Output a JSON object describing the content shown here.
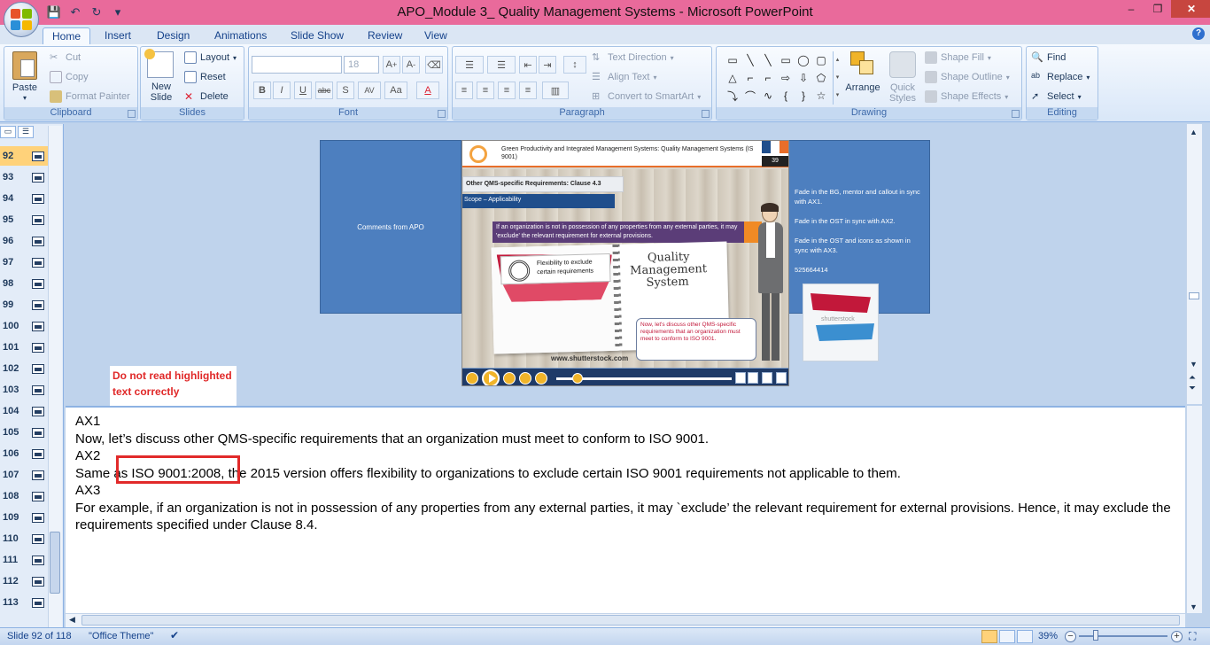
{
  "window": {
    "title": "APO_Module 3_ Quality Management Systems - Microsoft PowerPoint",
    "minimize": "–",
    "restore": "❐",
    "close": "✕"
  },
  "qat": {
    "save": "💾",
    "undo": "↶",
    "redo": "↻",
    "customize": "▾"
  },
  "tabs": [
    "Home",
    "Insert",
    "Design",
    "Animations",
    "Slide Show",
    "Review",
    "View"
  ],
  "ribbon": {
    "clipboard": {
      "label": "Clipboard",
      "paste": "Paste",
      "cut": "Cut",
      "copy": "Copy",
      "format_painter": "Format Painter"
    },
    "slides": {
      "label": "Slides",
      "new_slide": "New Slide",
      "layout": "Layout",
      "reset": "Reset",
      "delete": "Delete"
    },
    "font": {
      "label": "Font",
      "font_name": "",
      "font_size": "18",
      "bold": "B",
      "italic": "I",
      "underline": "U",
      "strike": "abc",
      "shadow": "S",
      "spacing": "AV",
      "case": "Aa",
      "color": "A"
    },
    "paragraph": {
      "label": "Paragraph",
      "text_direction": "Text Direction",
      "align_text": "Align Text",
      "convert_smartart": "Convert to SmartArt"
    },
    "drawing": {
      "label": "Drawing",
      "arrange": "Arrange",
      "quick_styles": "Quick Styles",
      "shape_fill": "Shape Fill",
      "shape_outline": "Shape Outline",
      "shape_effects": "Shape Effects"
    },
    "editing": {
      "label": "Editing",
      "find": "Find",
      "replace": "Replace",
      "select": "Select"
    }
  },
  "slide_list": [
    "92",
    "93",
    "94",
    "95",
    "96",
    "97",
    "98",
    "99",
    "100",
    "101",
    "102",
    "103",
    "104",
    "105",
    "106",
    "107",
    "108",
    "109",
    "110",
    "111",
    "112",
    "113"
  ],
  "slide_pane": {
    "comments_box": "Comments from APO",
    "notes_box": [
      "Fade in the BG, mentor and callout in sync with AX1.",
      "Fade in the OST in sync with AX2.",
      "Fade in the OST and icons as shown in sync with AX3.",
      "525664414"
    ],
    "stock_label": "shutterstock"
  },
  "slide": {
    "header_title": "Green Productivity and Integrated Management Systems: Quality Management Systems (ISO 9001)",
    "page_number": "39",
    "clause_title": "Other QMS-specific Requirements: Clause 4.3",
    "scope": "Scope – Applicability",
    "purple_text": "If an organization is not in possession of any properties from any external parties, it may 'exclude' the relevant requirement for external provisions.",
    "card_text": "Flexibility to exclude certain requirements",
    "qms_line1": "Quality",
    "qms_line2": "Management",
    "qms_line3": "System",
    "bubble_text": "Now, let's discuss other QMS-specific requirements that an organization must meet to conform to ISO 9001.",
    "url": "www.shutterstock.com",
    "colors": {
      "orange": "#e86e2a",
      "navy": "#1f4e8c",
      "purple": "#5b3d78",
      "red": "#c2183a"
    }
  },
  "callout": "Do not read highlighted text correctly",
  "notes": {
    "lines": [
      "AX1",
      "Now, let’s discuss other QMS-specific requirements that an organization must meet to conform to ISO 9001.",
      "AX2",
      "Same as ISO 9001:2008, the 2015 version offers flexibility to organizations to exclude certain ISO 9001 requirements not applicable to them.",
      "AX3",
      "For example, if an organization is not in possession of any properties from any external parties, it may `exclude’ the relevant requirement for external provisions. Hence, it may exclude the requirements specified under Clause 8.4."
    ]
  },
  "status": {
    "slide_info": "Slide 92 of 118",
    "theme": "\"Office Theme\"",
    "zoom": "39%"
  }
}
